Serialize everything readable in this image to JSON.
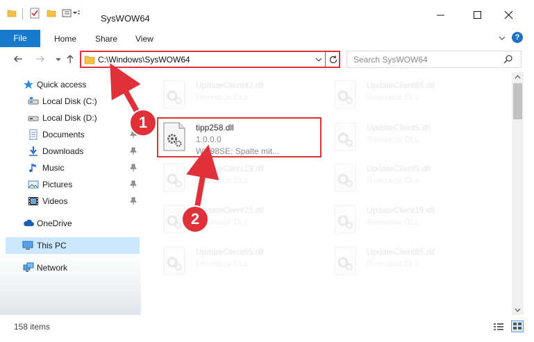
{
  "window": {
    "title": "SysWOW64",
    "controls": {
      "minimize": "minimize-icon",
      "maximize": "maximize-icon",
      "close": "close-icon"
    }
  },
  "ribbon": {
    "tabs": [
      {
        "label": "File"
      },
      {
        "label": "Home"
      },
      {
        "label": "Share"
      },
      {
        "label": "View"
      }
    ],
    "help": "?"
  },
  "navbar": {
    "address": "C:\\Windows\\SysWOW64",
    "search_placeholder": "Search SysWOW64"
  },
  "sidebar": {
    "items": [
      {
        "label": "Quick access",
        "icon": "star-icon"
      },
      {
        "label": "Local Disk (C:)",
        "icon": "drive-icon"
      },
      {
        "label": "Local Disk (D:)",
        "icon": "drive-icon"
      },
      {
        "label": "Documents",
        "icon": "documents-icon",
        "pinned": true
      },
      {
        "label": "Downloads",
        "icon": "downloads-icon",
        "pinned": true
      },
      {
        "label": "Music",
        "icon": "music-icon",
        "pinned": true
      },
      {
        "label": "Pictures",
        "icon": "pictures-icon",
        "pinned": true
      },
      {
        "label": "Videos",
        "icon": "videos-icon",
        "pinned": true
      },
      {
        "label": "OneDrive",
        "icon": "cloud-icon"
      },
      {
        "label": "This PC",
        "icon": "computer-icon",
        "selected": true
      },
      {
        "label": "Network",
        "icon": "network-icon"
      }
    ]
  },
  "files": [
    {
      "name": "UpdateClient42.dll",
      "type": "Resource DLL"
    },
    {
      "name": "UpdateClient65.dll",
      "type": "Resource DLL"
    },
    {
      "name": "tipp258.dll",
      "version": "1.0.0.0",
      "description": "Win98SE: Spalte mit...",
      "highlighted": true
    },
    {
      "name": "UpdateClient5.dll",
      "type": "Resource DLL"
    },
    {
      "name": "UpdateClient19.dll",
      "type": "Resource DLL"
    },
    {
      "name": "UpdateClient5.dll",
      "type": "Resource DLL"
    },
    {
      "name": "UpdateClient21.dll",
      "type": "Resource DLL"
    },
    {
      "name": "UpdateClient19.dll",
      "type": "Resource DLL"
    },
    {
      "name": "UpdateClient65.dll",
      "type": "Resource DLL"
    },
    {
      "name": "UpdateClient65.dll",
      "type": "Resource DLL"
    }
  ],
  "status": {
    "item_count": "158 items"
  },
  "annotations": {
    "step1": "1",
    "step2": "2",
    "color": "#e0303a"
  },
  "colors": {
    "file_tab": "#1979ca",
    "selection": "#cce8ff",
    "highlight": "#e0303a"
  }
}
